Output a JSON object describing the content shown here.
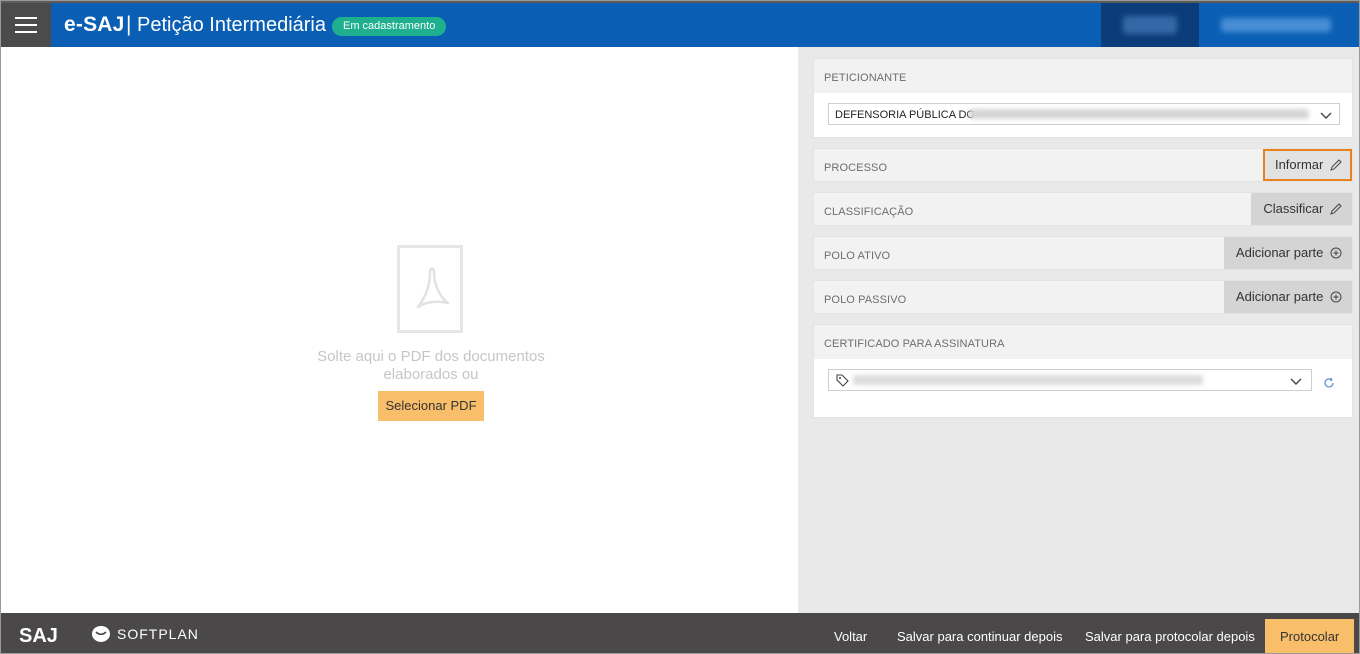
{
  "header": {
    "brand": "e-SAJ",
    "separator": "|",
    "title": "Petição Intermediária",
    "status_badge": "Em cadastramento",
    "menu_icon": "hamburger-icon",
    "colors": {
      "header_bg": "#0a5fb4",
      "badge_bg": "#1eb08e",
      "menu_bg": "#4b4b4b"
    }
  },
  "dropzone": {
    "icon": "pdf-file-icon",
    "text": "Solte aqui o PDF dos documentos elaborados ou",
    "button_label": "Selecionar PDF"
  },
  "panel": {
    "peticionante": {
      "label": "PETICIONANTE",
      "selected_value": "DEFENSORIA PÚBLICA DO"
    },
    "processo": {
      "label": "PROCESSO",
      "action_label": "Informar"
    },
    "classificacao": {
      "label": "CLASSIFICAÇÃO",
      "action_label": "Classificar"
    },
    "polo_ativo": {
      "label": "POLO ATIVO",
      "action_label": "Adicionar parte"
    },
    "polo_passivo": {
      "label": "POLO PASSIVO",
      "action_label": "Adicionar parte"
    },
    "certificado": {
      "label": "CERTIFICADO PARA ASSINATURA",
      "selected_value": ""
    }
  },
  "footer": {
    "saj_logo": "SAJ",
    "softplan_logo": "SOFTPLAN",
    "buttons": {
      "voltar": "Voltar",
      "salvar_continuar": "Salvar para continuar depois",
      "salvar_protocolar": "Salvar para protocolar depois",
      "protocolar": "Protocolar"
    },
    "colors": {
      "accent": "#f9be6a",
      "bg": "#4a4848"
    }
  }
}
